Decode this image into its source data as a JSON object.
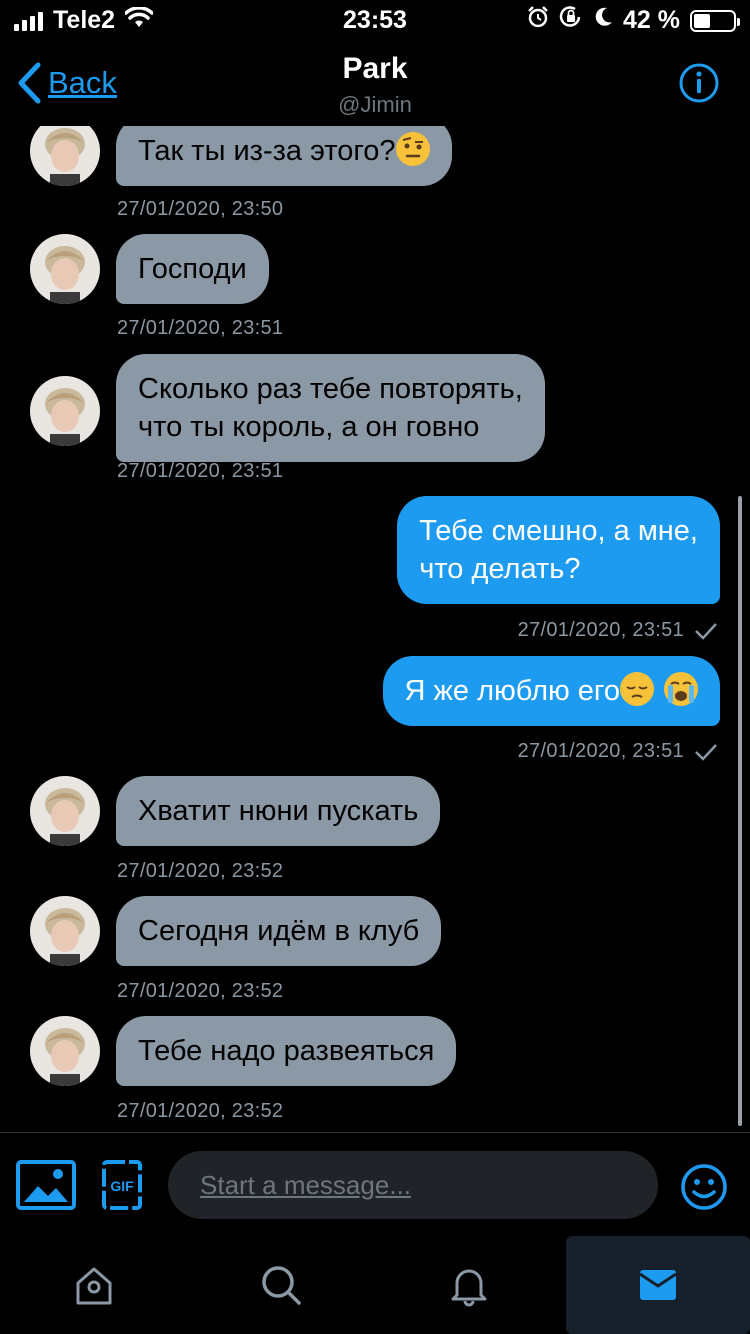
{
  "status_bar": {
    "carrier": "Tele2",
    "time": "23:53",
    "battery": "42 %",
    "battery_level": 0.42
  },
  "header": {
    "back_label": "Back",
    "title": "Park",
    "username": "@Jimin"
  },
  "messages": [
    {
      "direction": "in",
      "text": "Так ты из-за этого?",
      "emoji": "face-with-raised-eyebrow",
      "timestamp": "27/01/2020, 23:50"
    },
    {
      "direction": "in",
      "text": "Господи",
      "timestamp": "27/01/2020, 23:51"
    },
    {
      "direction": "in",
      "lines": [
        "Сколько раз тебе повторять,",
        "что ты король, а он говно"
      ],
      "timestamp": "27/01/2020, 23:51"
    },
    {
      "direction": "out",
      "lines": [
        "Тебе смешно, а мне,",
        "что делать?"
      ],
      "timestamp": "27/01/2020, 23:51",
      "status": "sent"
    },
    {
      "direction": "out",
      "text": "Я же люблю его",
      "emoji": [
        "pensive-face",
        "loudly-crying-face"
      ],
      "timestamp": "27/01/2020, 23:51",
      "status": "sent"
    },
    {
      "direction": "in",
      "text": "Хватит нюни пускать",
      "timestamp": "27/01/2020, 23:52"
    },
    {
      "direction": "in",
      "text": "Сегодня идём в клуб",
      "timestamp": "27/01/2020, 23:52"
    },
    {
      "direction": "in",
      "text": "Тебе надо развеяться",
      "timestamp": "27/01/2020, 23:52"
    }
  ],
  "composer": {
    "placeholder": "Start a message...",
    "gif_label": "GIF"
  },
  "tabs": [
    {
      "icon": "home-icon",
      "active": false
    },
    {
      "icon": "search-icon",
      "active": false
    },
    {
      "icon": "bell-icon",
      "active": false
    },
    {
      "icon": "mail-icon",
      "active": true
    }
  ],
  "colors": {
    "accent": "#1d9bf0",
    "incoming_bubble": "#8b98a5",
    "background": "#000000"
  }
}
